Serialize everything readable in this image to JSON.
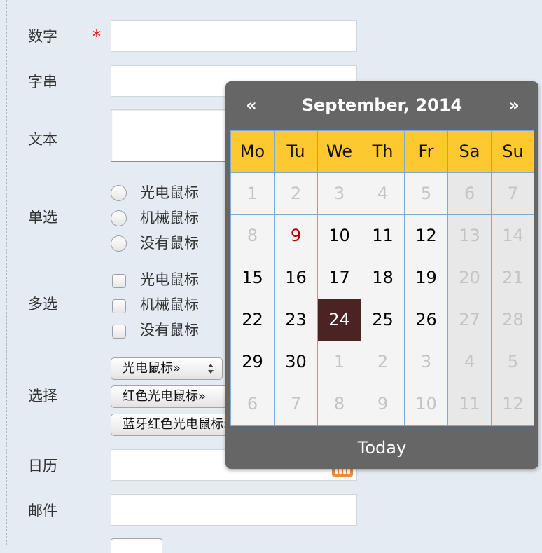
{
  "form": {
    "number_label": "数字",
    "required_mark": "*",
    "string_label": "字串",
    "text_label": "文本",
    "single_label": "单选",
    "multi_label": "多选",
    "select_label": "选择",
    "date_label": "日历",
    "email_label": "邮件",
    "radio_options": [
      "光电鼠标",
      "机械鼠标",
      "没有鼠标"
    ],
    "checkbox_options": [
      "光电鼠标",
      "机械鼠标",
      "没有鼠标"
    ],
    "selects": [
      "光电鼠标»",
      "红色光电鼠标»",
      "蓝牙红色光电鼠标»"
    ]
  },
  "calendar": {
    "prev": "«",
    "next": "»",
    "title": "September, 2014",
    "weekdays": [
      "Mo",
      "Tu",
      "We",
      "Th",
      "Fr",
      "Sa",
      "Su"
    ],
    "weeks": [
      [
        "1",
        "2",
        "3",
        "4",
        "5",
        "6",
        "7"
      ],
      [
        "8",
        "9",
        "10",
        "11",
        "12",
        "13",
        "14"
      ],
      [
        "15",
        "16",
        "17",
        "18",
        "19",
        "20",
        "21"
      ],
      [
        "22",
        "23",
        "24",
        "25",
        "26",
        "27",
        "28"
      ],
      [
        "29",
        "30",
        "1",
        "2",
        "3",
        "4",
        "5"
      ],
      [
        "6",
        "7",
        "8",
        "9",
        "10",
        "11",
        "12"
      ]
    ],
    "today_label": "Today",
    "selected_day": "24",
    "colors": {
      "header_bg": "#fec82f",
      "selected_bg": "#4a2322",
      "today_text": "#b00000",
      "panel_bg": "#666666"
    }
  }
}
